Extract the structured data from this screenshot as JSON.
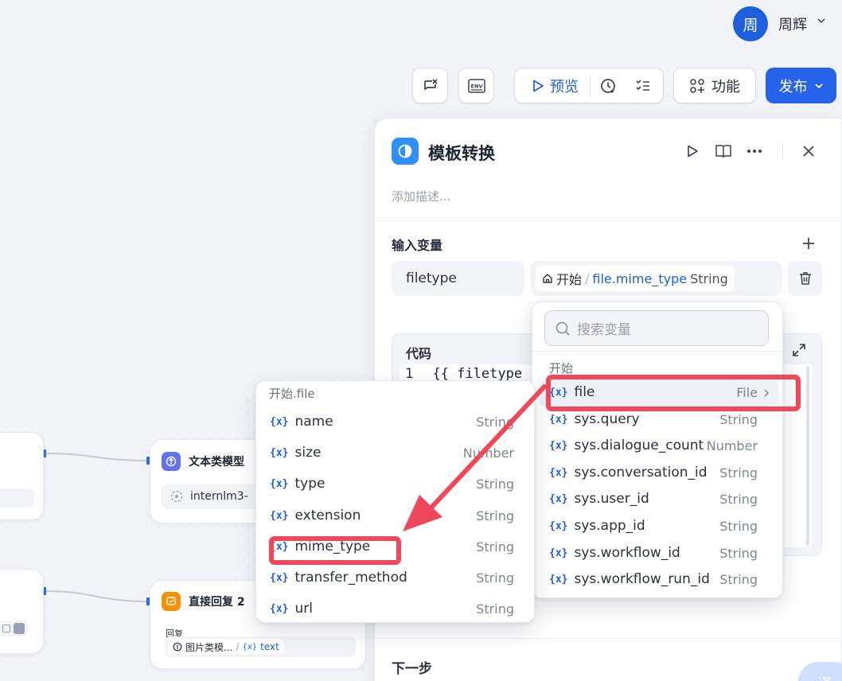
{
  "header": {
    "avatar_text": "周",
    "user_name": "周辉",
    "preview_label": "预览",
    "features_label": "功能",
    "publish_label": "发布",
    "env_badge": "ENV"
  },
  "canvas": {
    "nodes": [
      {
        "title": "文本类模型",
        "model": "internlm3-"
      },
      {
        "title": "直接回复 2",
        "reply_label": "回复",
        "ref_node": "图片类模...",
        "ref_sep": "/",
        "ref_var": "text"
      }
    ]
  },
  "panel": {
    "title": "模板转换",
    "description_placeholder": "添加描述...",
    "input_section_title": "输入变量",
    "variable_name": "filetype",
    "variable_source_node": "开始",
    "variable_path_sep": "/",
    "variable_path": "file.mime_type",
    "variable_type": "String",
    "code_label": "代码",
    "code_line_number": "1",
    "code_line_text": "{{ filetype",
    "next_step_title": "下一步",
    "float_badge": "译"
  },
  "var_picker": {
    "search_placeholder": "搜索变量",
    "group_title": "开始",
    "items": [
      {
        "name": "file",
        "type": "File"
      },
      {
        "name": "sys.query",
        "type": "String"
      },
      {
        "name": "sys.dialogue_count",
        "type": "Number"
      },
      {
        "name": "sys.conversation_id",
        "type": "String"
      },
      {
        "name": "sys.user_id",
        "type": "String"
      },
      {
        "name": "sys.app_id",
        "type": "String"
      },
      {
        "name": "sys.workflow_id",
        "type": "String"
      },
      {
        "name": "sys.workflow_run_id",
        "type": "String"
      }
    ]
  },
  "file_submenu": {
    "title": "开始.file",
    "items": [
      {
        "name": "name",
        "type": "String"
      },
      {
        "name": "size",
        "type": "Number"
      },
      {
        "name": "type",
        "type": "String"
      },
      {
        "name": "extension",
        "type": "String"
      },
      {
        "name": "mime_type",
        "type": "String"
      },
      {
        "name": "transfer_method",
        "type": "String"
      },
      {
        "name": "url",
        "type": "String"
      }
    ]
  },
  "colors": {
    "accent": "#2563eb",
    "annotation_red": "#f0475a",
    "node_icon_purple": "#6172f3",
    "node_icon_orange": "#f79009",
    "panel_icon_blue": "#2e90fa"
  }
}
